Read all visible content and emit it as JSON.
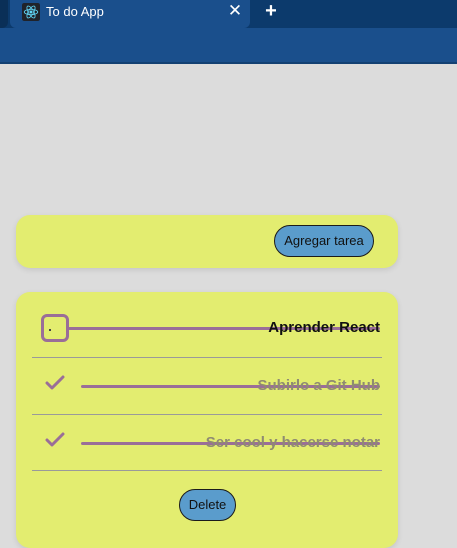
{
  "browser": {
    "tab_title": "To do App",
    "tab_icon": "react-logo-icon",
    "close_glyph": "✕",
    "new_tab_glyph": "+"
  },
  "colors": {
    "chrome_dark": "#0c3a6c",
    "chrome_tab": "#1a4f8c",
    "page_bg": "#dcdcdc",
    "card_bg": "#e3ed70",
    "button_bg": "#5a9ccc",
    "accent_purple": "#9a6e98"
  },
  "add_card": {
    "add_button_label": "Agregar tarea"
  },
  "task_list": {
    "tasks": [
      {
        "text": "Aprender React",
        "completed": false,
        "indicator": "checkbox-icon"
      },
      {
        "text": "Subirlo a Git Hub",
        "completed": true,
        "indicator": "checkmark-icon"
      },
      {
        "text": "Ser cool y hacerse notar",
        "completed": true,
        "indicator": "checkmark-icon"
      }
    ],
    "delete_button_label": "Delete"
  }
}
